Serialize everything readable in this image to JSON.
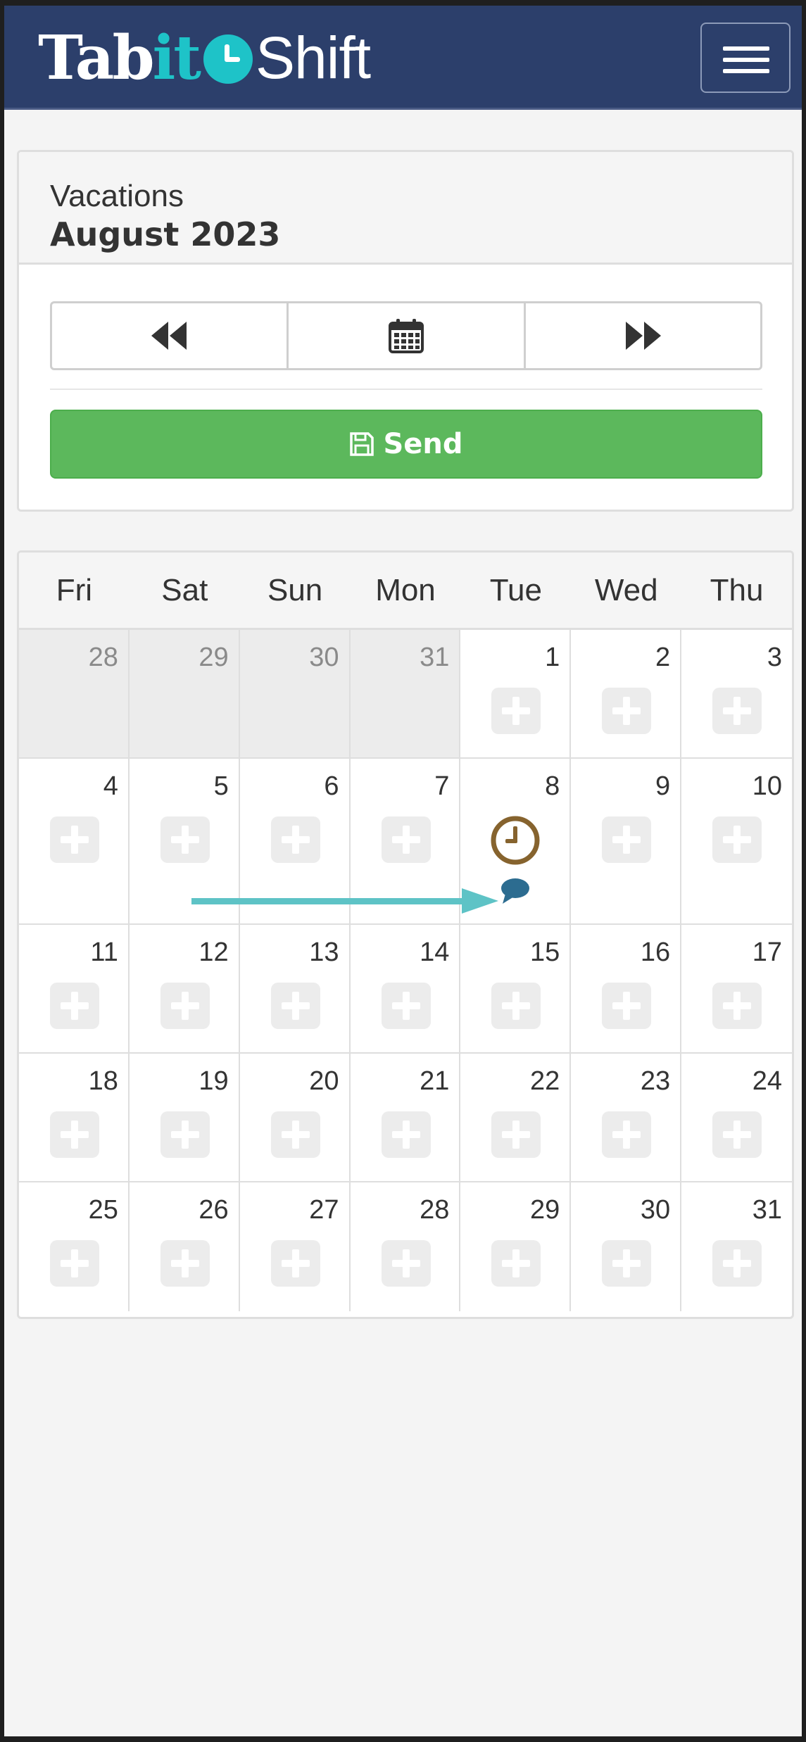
{
  "app": {
    "brand_tab": "Tab",
    "brand_it": "it",
    "brand_shift": "Shift",
    "brand_colors": {
      "navy": "#2c3f6b",
      "teal": "#1ec3c8"
    }
  },
  "panel": {
    "title": "Vacations",
    "month": "August 2023",
    "prev_icon": "fast-backward-icon",
    "calendar_icon": "calendar-icon",
    "next_icon": "fast-forward-icon",
    "send_label": "Send",
    "send_icon": "floppy-disk-icon"
  },
  "calendar": {
    "weekdays": [
      "Fri",
      "Sat",
      "Sun",
      "Mon",
      "Tue",
      "Wed",
      "Thu"
    ],
    "weeks": [
      [
        {
          "day": "28",
          "muted": true
        },
        {
          "day": "29",
          "muted": true
        },
        {
          "day": "30",
          "muted": true
        },
        {
          "day": "31",
          "muted": true
        },
        {
          "day": "1"
        },
        {
          "day": "2"
        },
        {
          "day": "3"
        }
      ],
      [
        {
          "day": "4"
        },
        {
          "day": "5"
        },
        {
          "day": "6"
        },
        {
          "day": "7"
        },
        {
          "day": "8",
          "icons": [
            "clock-icon",
            "comment-icon"
          ]
        },
        {
          "day": "9"
        },
        {
          "day": "10"
        }
      ],
      [
        {
          "day": "11"
        },
        {
          "day": "12"
        },
        {
          "day": "13"
        },
        {
          "day": "14"
        },
        {
          "day": "15"
        },
        {
          "day": "16"
        },
        {
          "day": "17"
        }
      ],
      [
        {
          "day": "18"
        },
        {
          "day": "19"
        },
        {
          "day": "20"
        },
        {
          "day": "21"
        },
        {
          "day": "22"
        },
        {
          "day": "23"
        },
        {
          "day": "24"
        }
      ],
      [
        {
          "day": "25"
        },
        {
          "day": "26"
        },
        {
          "day": "27"
        },
        {
          "day": "28"
        },
        {
          "day": "29"
        },
        {
          "day": "30"
        },
        {
          "day": "31"
        }
      ]
    ],
    "colors": {
      "clock": "#86632e",
      "comment": "#2c6c90",
      "arrow": "#5ec3c6",
      "send": "#5cb85c"
    }
  }
}
